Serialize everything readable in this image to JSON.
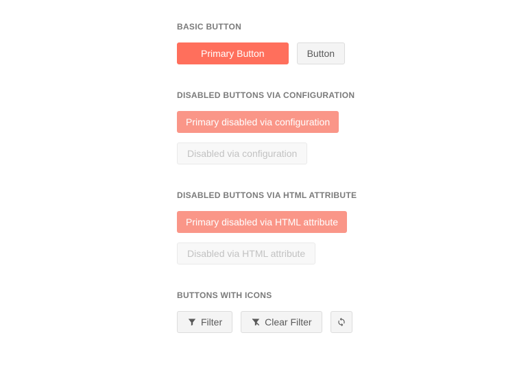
{
  "sections": {
    "basic": {
      "heading": "BASIC BUTTON",
      "primary_label": "Primary Button",
      "default_label": "Button"
    },
    "disabled_config": {
      "heading": "DISABLED BUTTONS VIA CONFIGURATION",
      "primary_label": "Primary disabled via configuration",
      "default_label": "Disabled via configuration"
    },
    "disabled_html": {
      "heading": "DISABLED BUTTONS VIA HTML ATTRIBUTE",
      "primary_label": "Primary disabled via HTML attribute",
      "default_label": "Disabled via HTML attribute"
    },
    "icons": {
      "heading": "BUTTONS WITH ICONS",
      "filter_label": "Filter",
      "clear_filter_label": "Clear Filter"
    }
  }
}
